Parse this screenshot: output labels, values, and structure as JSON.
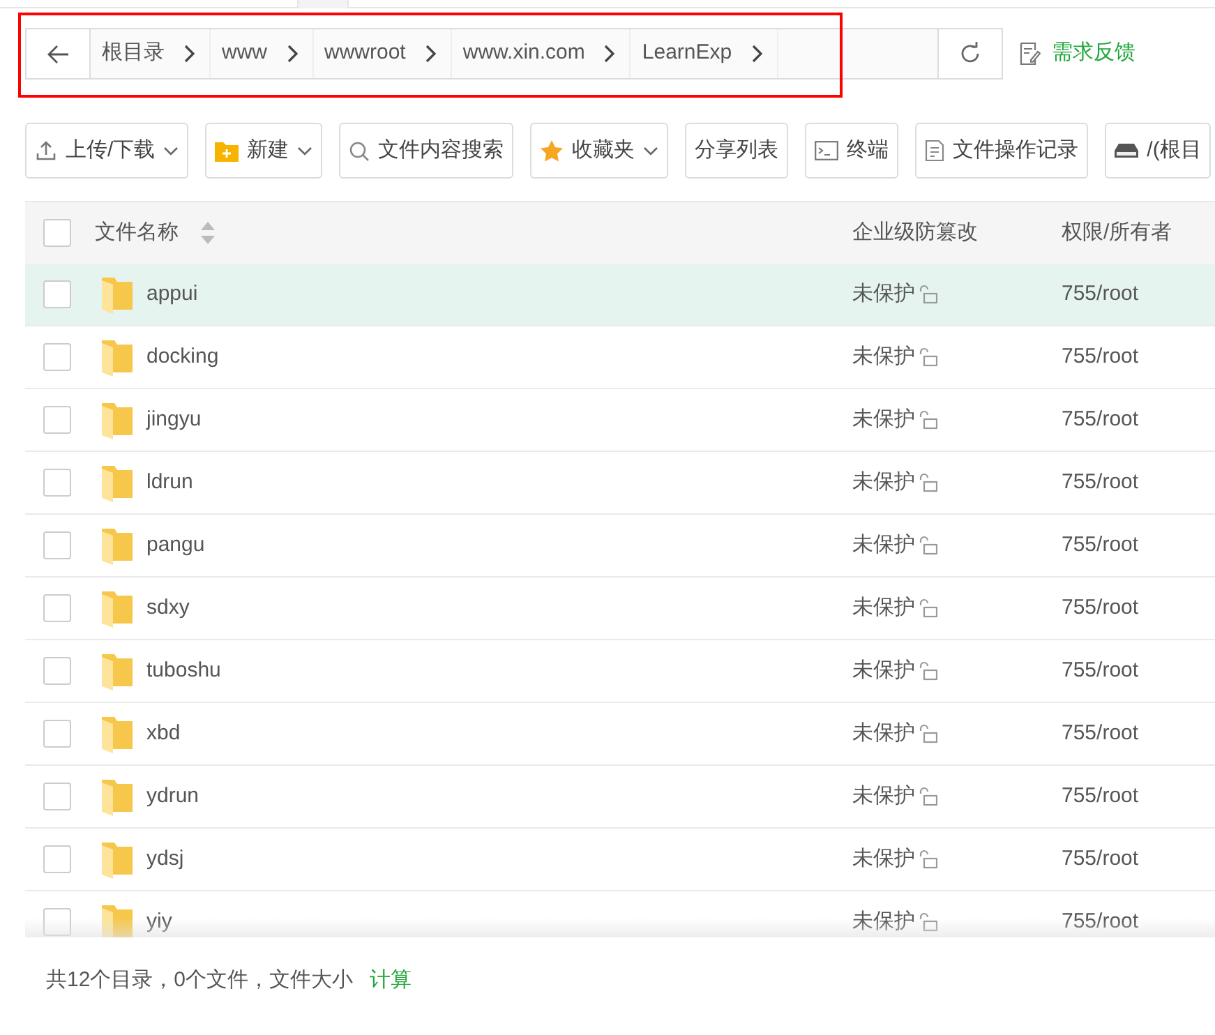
{
  "breadcrumb": {
    "crumbs": [
      "根目录",
      "www",
      "wwwroot",
      "www.xin.com",
      "LearnExp"
    ],
    "highlighted": true
  },
  "feedback": "需求反馈",
  "toolbar": [
    {
      "label": "上传/下载",
      "dropdown": true
    },
    {
      "label": "新建",
      "dropdown": true
    },
    {
      "label": "文件内容搜索",
      "dropdown": false
    },
    {
      "label": "收藏夹",
      "dropdown": true
    },
    {
      "label": "分享列表",
      "dropdown": false
    },
    {
      "label": "终端",
      "dropdown": false
    },
    {
      "label": "文件操作记录",
      "dropdown": false
    },
    {
      "label": "/(根目",
      "dropdown": false
    }
  ],
  "table": {
    "all_checked": false,
    "columns": [
      "文件名称",
      "企业级防篡改",
      "权限/所有者"
    ],
    "rows": [
      {
        "name": "appui",
        "protection": "未保护",
        "permission": "755/root",
        "hovered": true,
        "checked": false
      },
      {
        "name": "docking",
        "protection": "未保护",
        "permission": "755/root",
        "hovered": false,
        "checked": false
      },
      {
        "name": "jingyu",
        "protection": "未保护",
        "permission": "755/root",
        "hovered": false,
        "checked": false
      },
      {
        "name": "ldrun",
        "protection": "未保护",
        "permission": "755/root",
        "hovered": false,
        "checked": false
      },
      {
        "name": "pangu",
        "protection": "未保护",
        "permission": "755/root",
        "hovered": false,
        "checked": false
      },
      {
        "name": "sdxy",
        "protection": "未保护",
        "permission": "755/root",
        "hovered": false,
        "checked": false
      },
      {
        "name": "tuboshu",
        "protection": "未保护",
        "permission": "755/root",
        "hovered": false,
        "checked": false
      },
      {
        "name": "xbd",
        "protection": "未保护",
        "permission": "755/root",
        "hovered": false,
        "checked": false
      },
      {
        "name": "ydrun",
        "protection": "未保护",
        "permission": "755/root",
        "hovered": false,
        "checked": false
      },
      {
        "name": "ydsj",
        "protection": "未保护",
        "permission": "755/root",
        "hovered": false,
        "checked": false
      },
      {
        "name": "yiy",
        "protection": "未保护",
        "permission": "755/root",
        "hovered": false,
        "checked": false
      }
    ]
  },
  "footer": {
    "summary": "共12个目录，0个文件，文件大小",
    "link": "计算"
  }
}
